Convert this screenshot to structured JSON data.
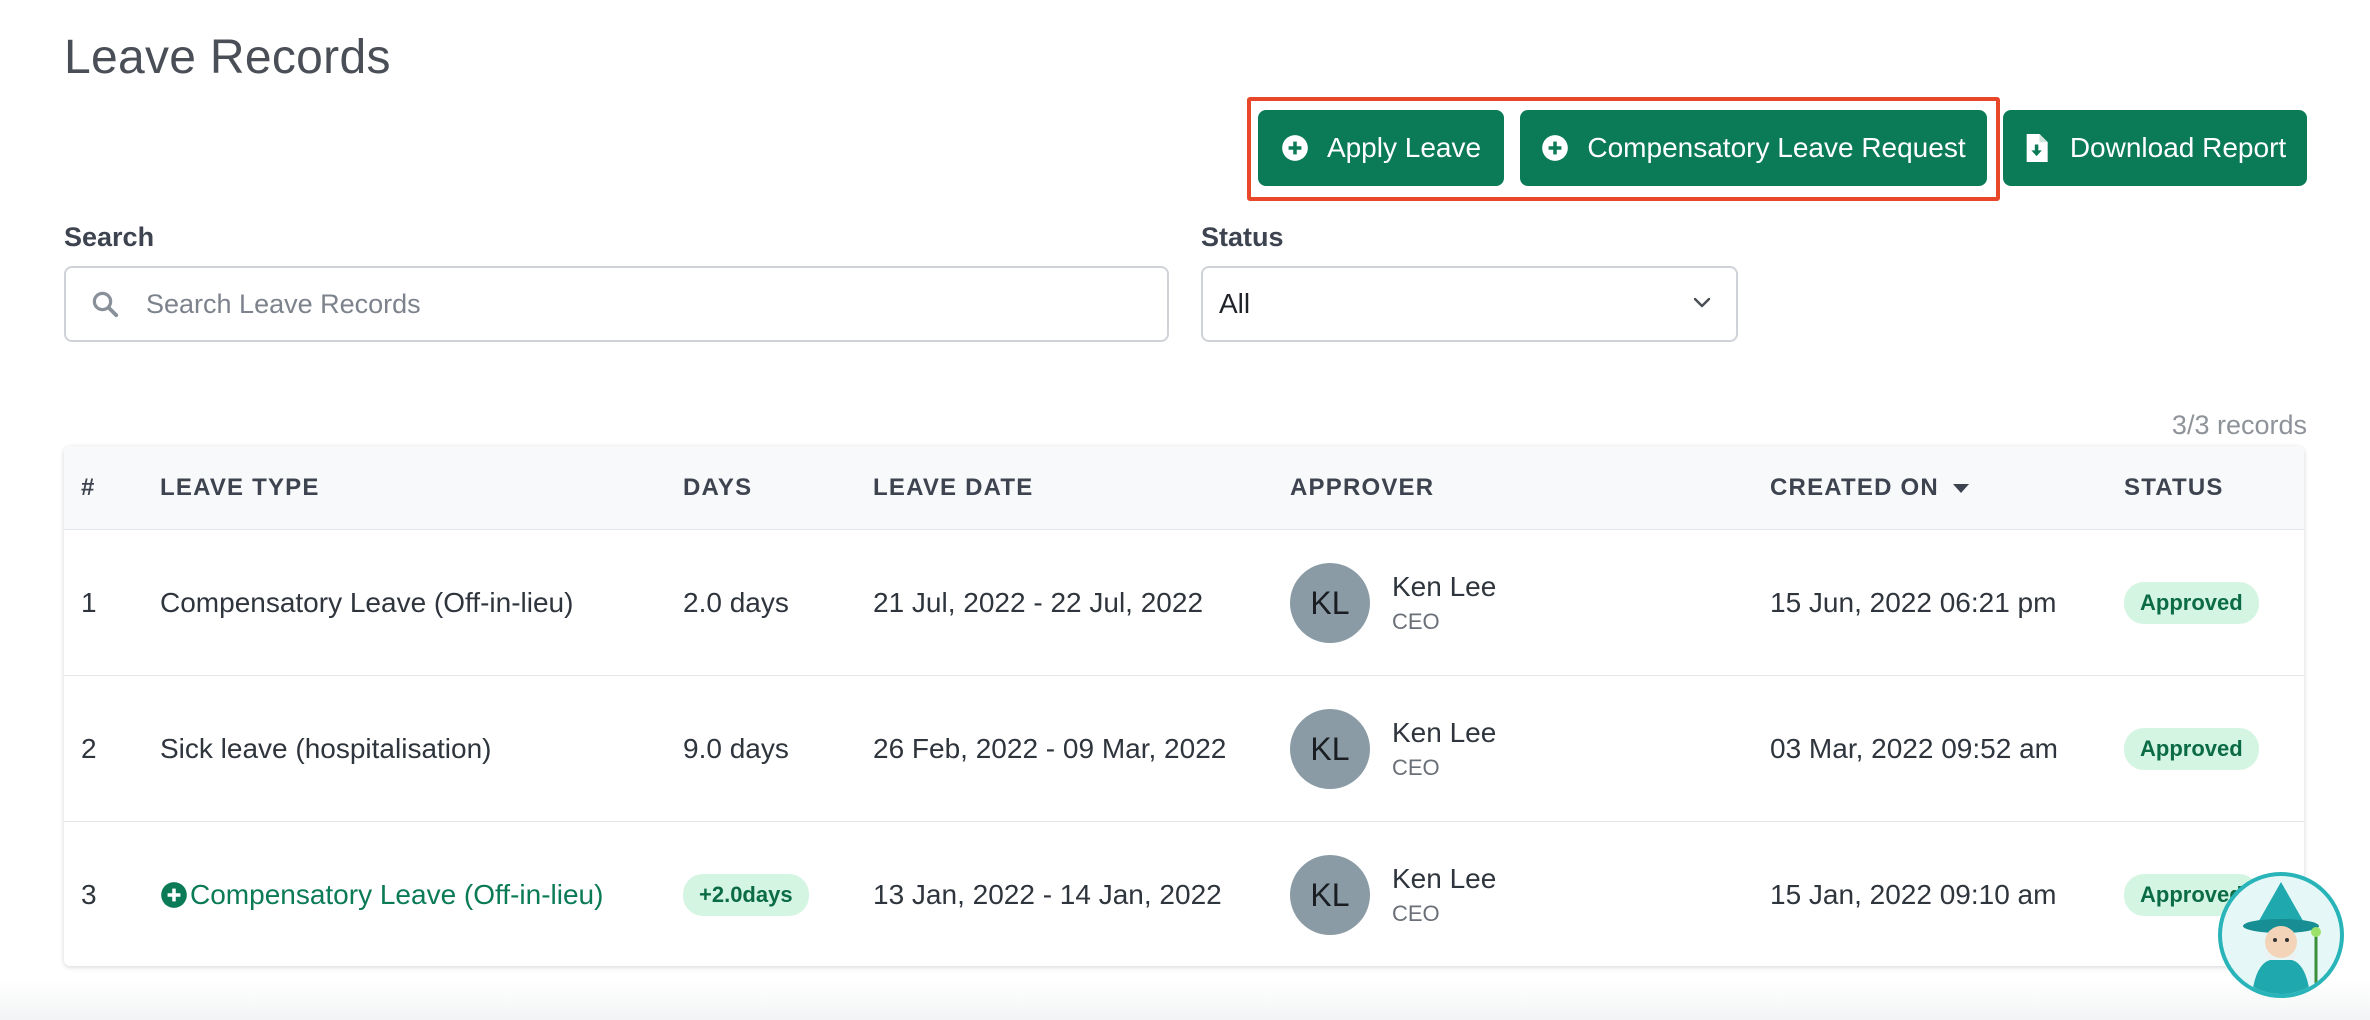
{
  "page": {
    "title": "Leave Records"
  },
  "actions": {
    "apply_leave": "Apply Leave",
    "compensatory_request": "Compensatory Leave Request",
    "download_report": "Download Report"
  },
  "filters": {
    "search_label": "Search",
    "search_placeholder": "Search Leave Records",
    "search_value": "",
    "status_label": "Status",
    "status_value": "All"
  },
  "records_count": "3/3 records",
  "table": {
    "headers": {
      "num": "#",
      "leave_type": "LEAVE TYPE",
      "days": "DAYS",
      "leave_date": "LEAVE DATE",
      "approver": "APPROVER",
      "created_on": "CREATED ON",
      "status": "STATUS"
    },
    "rows": [
      {
        "num": "1",
        "leave_type": "Compensatory Leave (Off-in-lieu)",
        "days": "2.0 days",
        "leave_date": "21 Jul, 2022 - 22 Jul, 2022",
        "approver_initials": "KL",
        "approver_name": "Ken Lee",
        "approver_role": "CEO",
        "created_on": "15 Jun, 2022 06:21 pm",
        "status": "Approved"
      },
      {
        "num": "2",
        "leave_type": "Sick leave (hospitalisation)",
        "days": "9.0 days",
        "leave_date": "26 Feb, 2022 - 09 Mar, 2022",
        "approver_initials": "KL",
        "approver_name": "Ken Lee",
        "approver_role": "CEO",
        "created_on": "03 Mar, 2022 09:52 am",
        "status": "Approved"
      },
      {
        "num": "3",
        "leave_type": "Compensatory Leave (Off-in-lieu)",
        "days": "+2.0days",
        "leave_date": "13 Jan, 2022 - 14 Jan, 2022",
        "approver_initials": "KL",
        "approver_name": "Ken Lee",
        "approver_role": "CEO",
        "created_on": "15 Jan, 2022 09:10 am",
        "status": "Approved"
      }
    ]
  },
  "colors": {
    "primary": "#0b7a57",
    "highlight": "#e8472a",
    "badge_bg": "#d5f5e3",
    "badge_text": "#0b6b45",
    "avatar_bg": "#8a9ba6"
  },
  "icons": {
    "apply": "plus-circle-icon",
    "compensatory": "plus-circle-icon",
    "download": "file-download-icon",
    "search": "search-icon",
    "status_dropdown": "chevron-down-icon",
    "sort": "caret-down-icon"
  }
}
